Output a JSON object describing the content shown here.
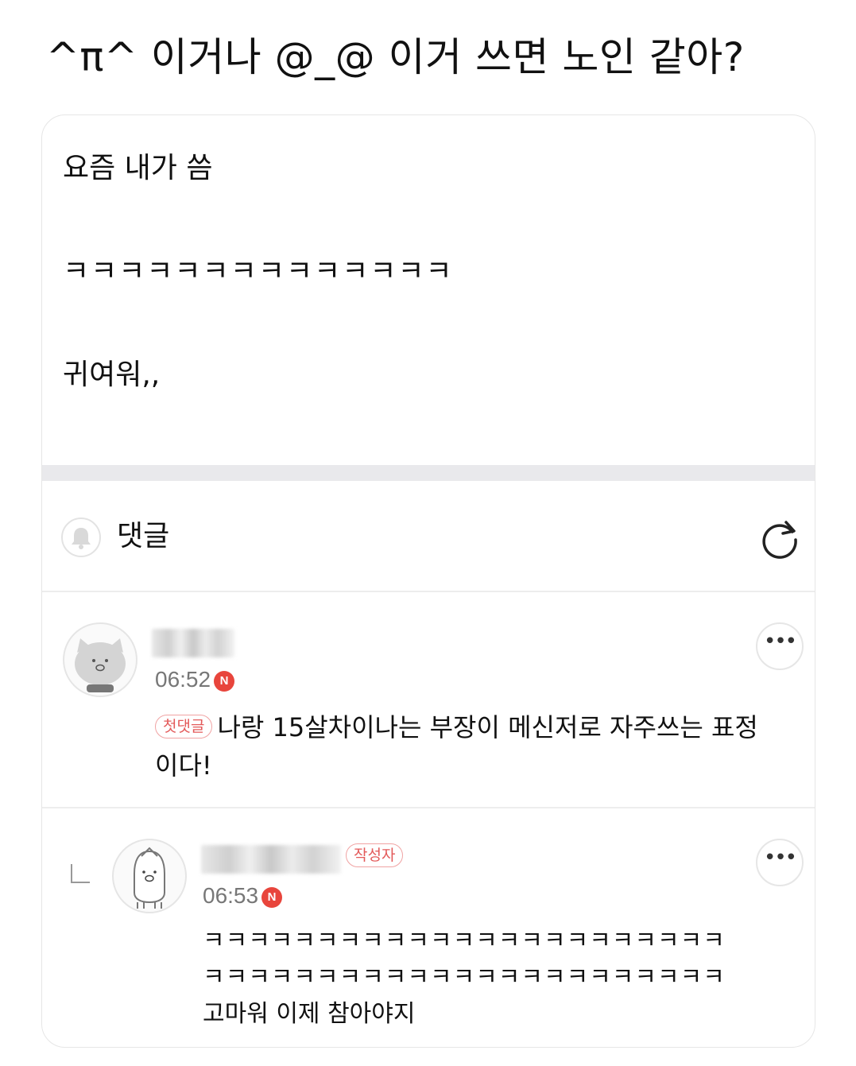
{
  "headline": "^π^ 이거나 @_@ 이거 쓰면 노인 같아?",
  "post": {
    "lines": [
      "요즘 내가 씀",
      "ㅋㅋㅋㅋㅋㅋㅋㅋㅋㅋㅋㅋㅋㅋ",
      "귀여워,,"
    ]
  },
  "comments_section": {
    "title": "댓글",
    "bell_icon": "bell-icon",
    "refresh_icon": "refresh-icon"
  },
  "comments": [
    {
      "time": "06:52",
      "new_badge": "N",
      "tag": "첫댓글",
      "text_line1": "나랑 15살차이나는 부장이 메신저로 자주쓰는 표정",
      "text_line2": "이다!",
      "more": "•••"
    },
    {
      "time": "06:53",
      "new_badge": "N",
      "author_tag": "작성자",
      "text_line1": "ㅋㅋㅋㅋㅋㅋㅋㅋㅋㅋㅋㅋㅋㅋㅋㅋㅋㅋㅋㅋㅋㅋㅋ",
      "text_line2": "ㅋㅋㅋㅋㅋㅋㅋㅋㅋㅋㅋㅋㅋㅋㅋㅋㅋㅋㅋㅋㅋㅋㅋ",
      "text_line3": "고마워 이제 참아야지",
      "more": "•••"
    }
  ]
}
